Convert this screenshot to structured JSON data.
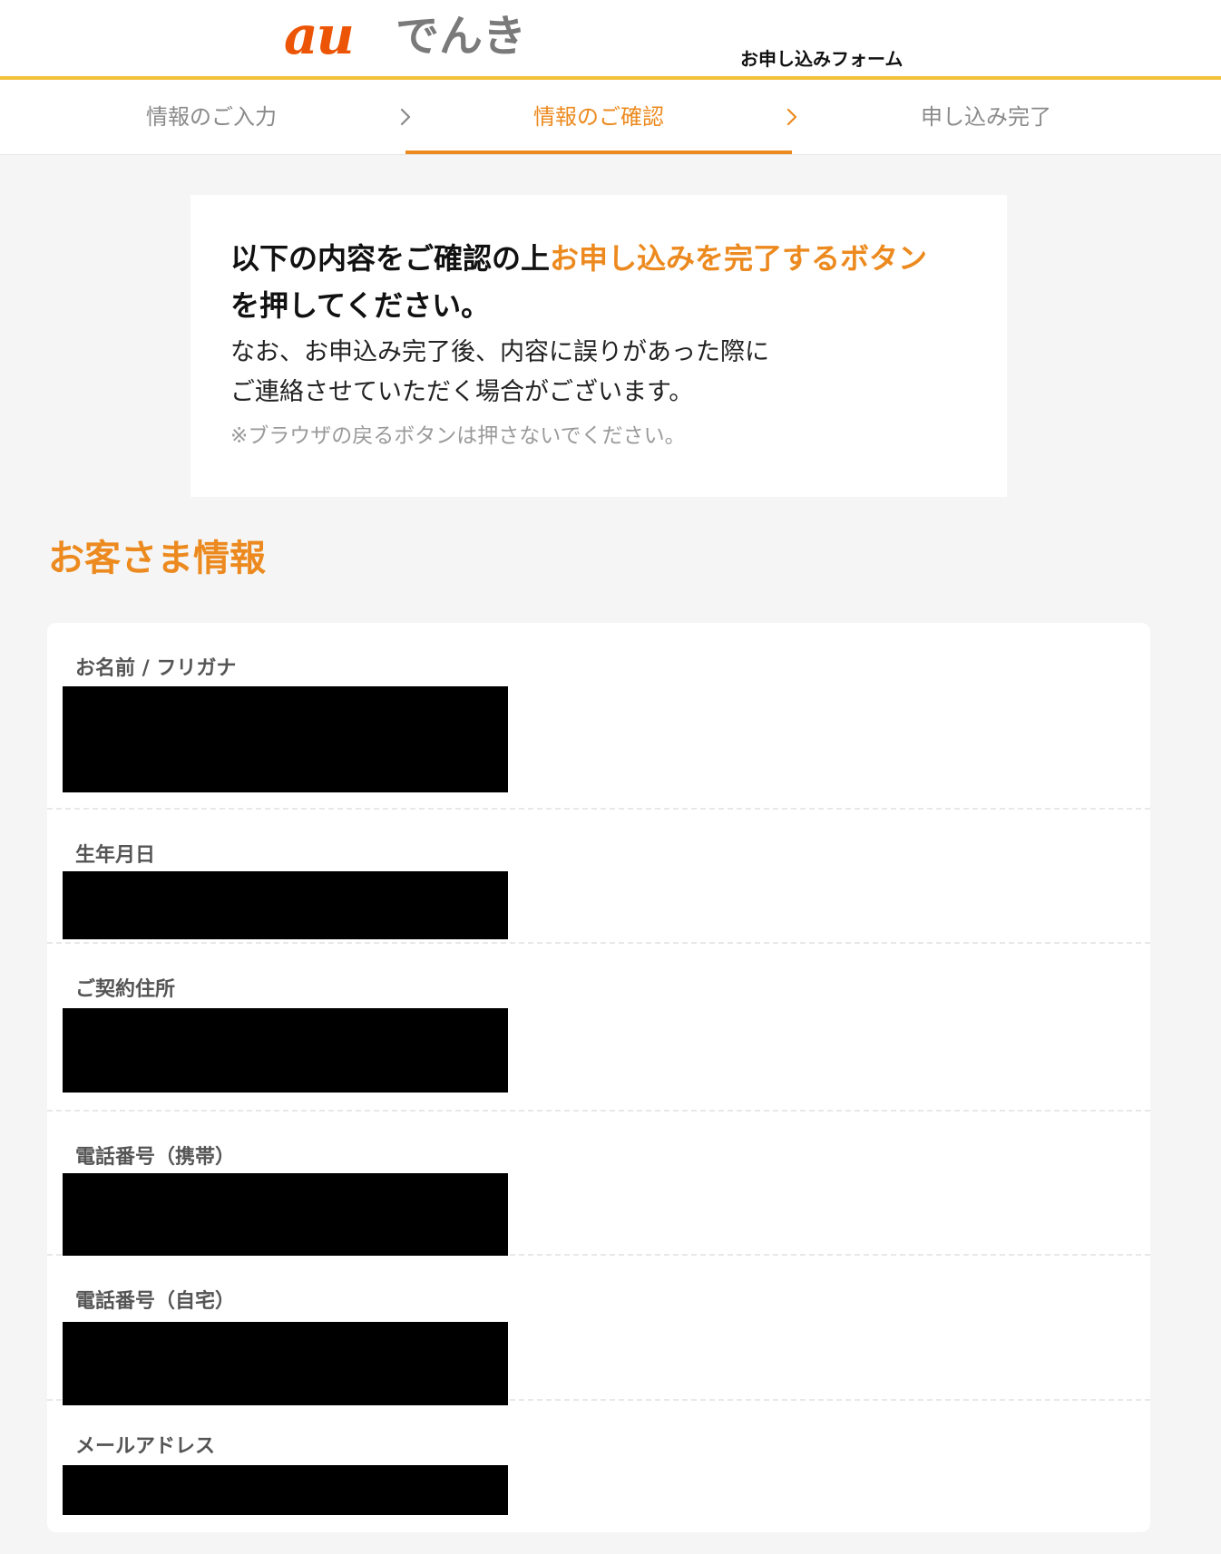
{
  "header": {
    "logo_au": "au",
    "logo_denki": "でんき",
    "form_title": "お申し込みフォーム",
    "accent_color": "#ec8a1f",
    "header_border_color": "#f3c23b"
  },
  "steps": [
    {
      "label": "情報のご入力",
      "state": "done"
    },
    {
      "label": "情報のご確認",
      "state": "active"
    },
    {
      "label": "申し込み完了",
      "state": "pending"
    }
  ],
  "notice": {
    "lead_prefix": "以下の内容をご確認の上",
    "lead_highlight": "お申し込みを完了するボタン",
    "lead_suffix": "を押してください。",
    "body_line1": "なお、お申込み完了後、内容に誤りがあった際に",
    "body_line2": "ご連絡させていただく場合がございます。",
    "note": "※ブラウザの戻るボタンは押さないでください。"
  },
  "customer": {
    "section_title": "お客さま情報",
    "fields": [
      {
        "label": "お名前 / フリガナ",
        "value": "[redacted]"
      },
      {
        "label": "生年月日",
        "value": "[redacted]"
      },
      {
        "label": "ご契約住所",
        "value": "[redacted]"
      },
      {
        "label": "電話番号（携帯）",
        "value": "[redacted]"
      },
      {
        "label": "電話番号（自宅）",
        "value": "[redacted]"
      },
      {
        "label": "メールアドレス",
        "value": "[redacted]"
      }
    ]
  }
}
